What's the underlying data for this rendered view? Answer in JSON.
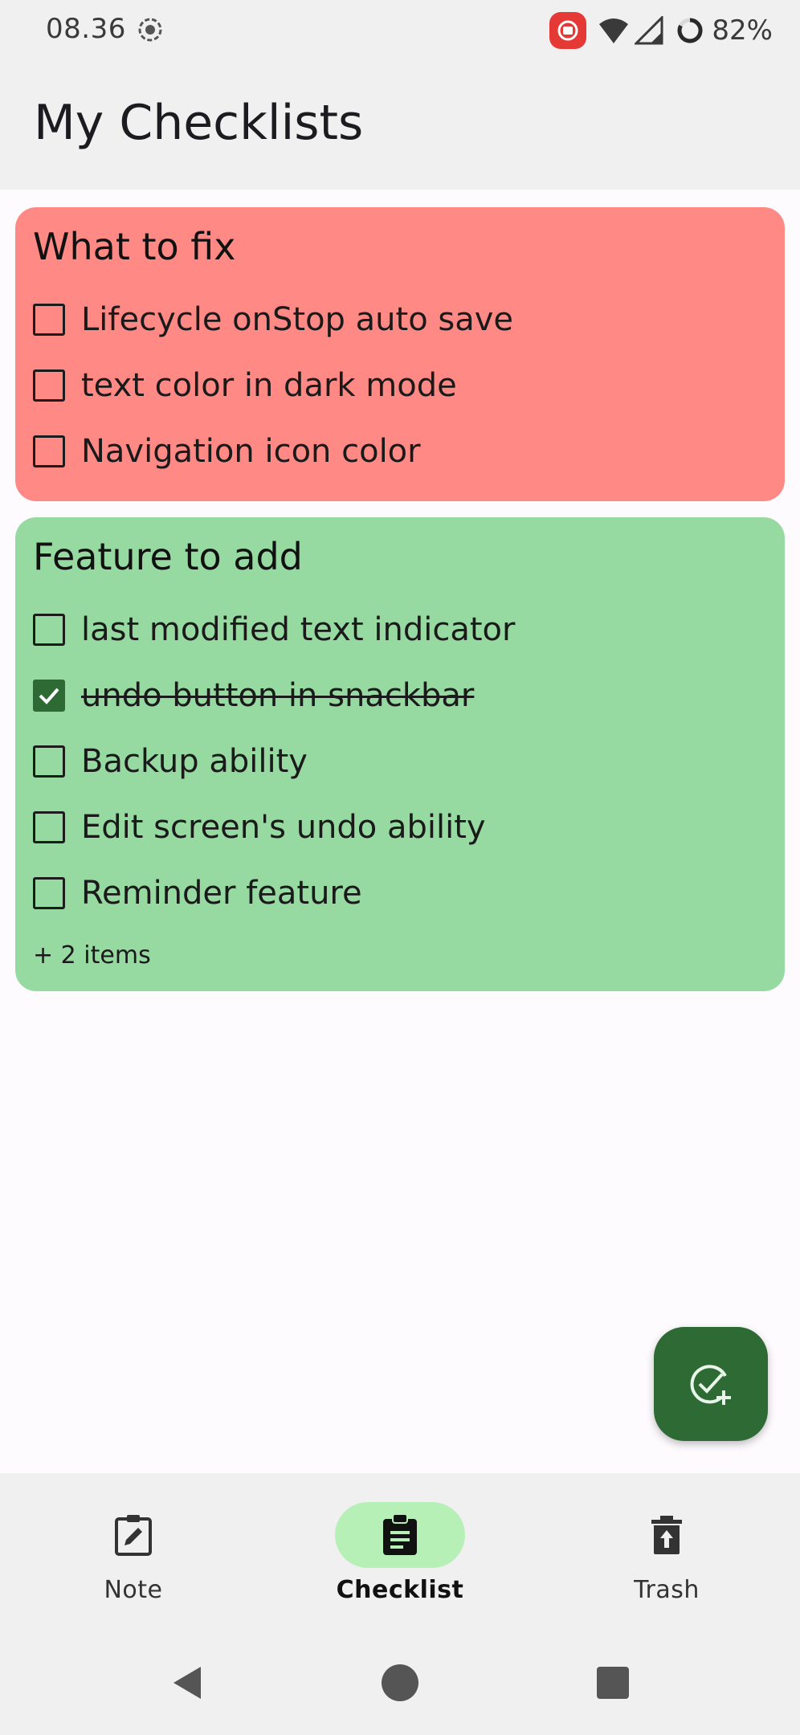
{
  "status_bar": {
    "time": "08.36",
    "battery_percent": "82%",
    "icons": [
      "screen-record-icon",
      "cast-icon",
      "wifi-icon",
      "signal-icon",
      "battery-icon"
    ]
  },
  "app_bar": {
    "title": "My Checklists"
  },
  "checklists": [
    {
      "title": "What to fix",
      "color": "#ff8a85",
      "items": [
        {
          "text": "Lifecycle onStop auto save",
          "checked": false
        },
        {
          "text": "text color in dark mode",
          "checked": false
        },
        {
          "text": "Navigation icon color",
          "checked": false
        }
      ],
      "more": ""
    },
    {
      "title": "Feature to add",
      "color": "#96d9a1",
      "items": [
        {
          "text": "last modified text indicator",
          "checked": false
        },
        {
          "text": "undo button in snackbar",
          "checked": true
        },
        {
          "text": "Backup ability",
          "checked": false
        },
        {
          "text": "Edit screen's undo ability",
          "checked": false
        },
        {
          "text": "Reminder feature",
          "checked": false
        }
      ],
      "more": "+ 2 items"
    }
  ],
  "fab": {
    "icon": "add-checklist-icon",
    "color": "#2e6b34"
  },
  "bottom_nav": {
    "items": [
      {
        "label": "Note",
        "icon": "edit-note-icon",
        "active": false
      },
      {
        "label": "Checklist",
        "icon": "clipboard-icon",
        "active": true
      },
      {
        "label": "Trash",
        "icon": "trash-icon",
        "active": false
      }
    ],
    "active_color": "#b6f0b7"
  },
  "system_nav": {
    "buttons": [
      "back-icon",
      "home-icon",
      "recents-icon"
    ]
  }
}
